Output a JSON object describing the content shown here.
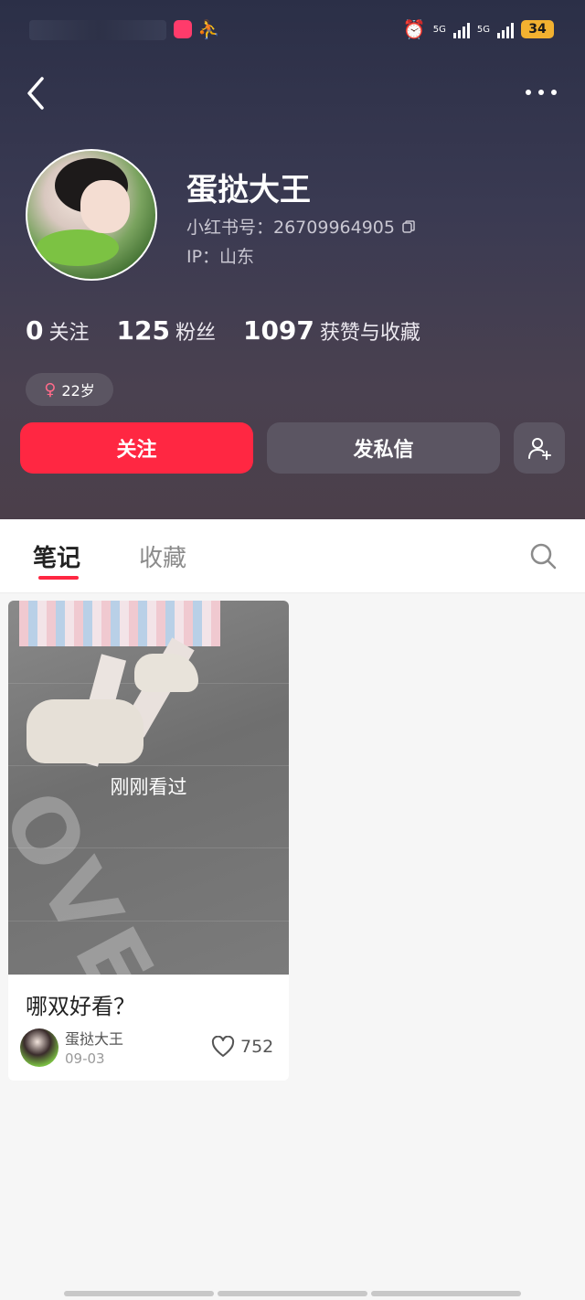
{
  "status_bar": {
    "network1": "5G",
    "network2": "5G",
    "battery": "34"
  },
  "profile": {
    "name": "蛋挞大王",
    "redbook_id_text": "小红书号：26709964905",
    "ip_text": "IP：山东",
    "stats": [
      {
        "num": "0",
        "label": "关注"
      },
      {
        "num": "125",
        "label": "粉丝"
      },
      {
        "num": "1097",
        "label": "获赞与收藏"
      }
    ],
    "tag": {
      "symbol": "♀",
      "text": "22岁"
    },
    "buttons": {
      "follow": "关注",
      "message": "发私信"
    }
  },
  "tabs": [
    {
      "label": "笔记",
      "active": true
    },
    {
      "label": "收藏",
      "active": false
    }
  ],
  "note": {
    "overlay": "刚刚看过",
    "watermark": "OVE",
    "title": "哪双好看？",
    "author": "蛋挞大王",
    "date": "09-03",
    "likes": "752"
  },
  "colors": {
    "accent": "#ff2742",
    "header_top": "#2b2f47",
    "header_bottom": "#4b3f4a",
    "button_dark": "#5b5562"
  }
}
